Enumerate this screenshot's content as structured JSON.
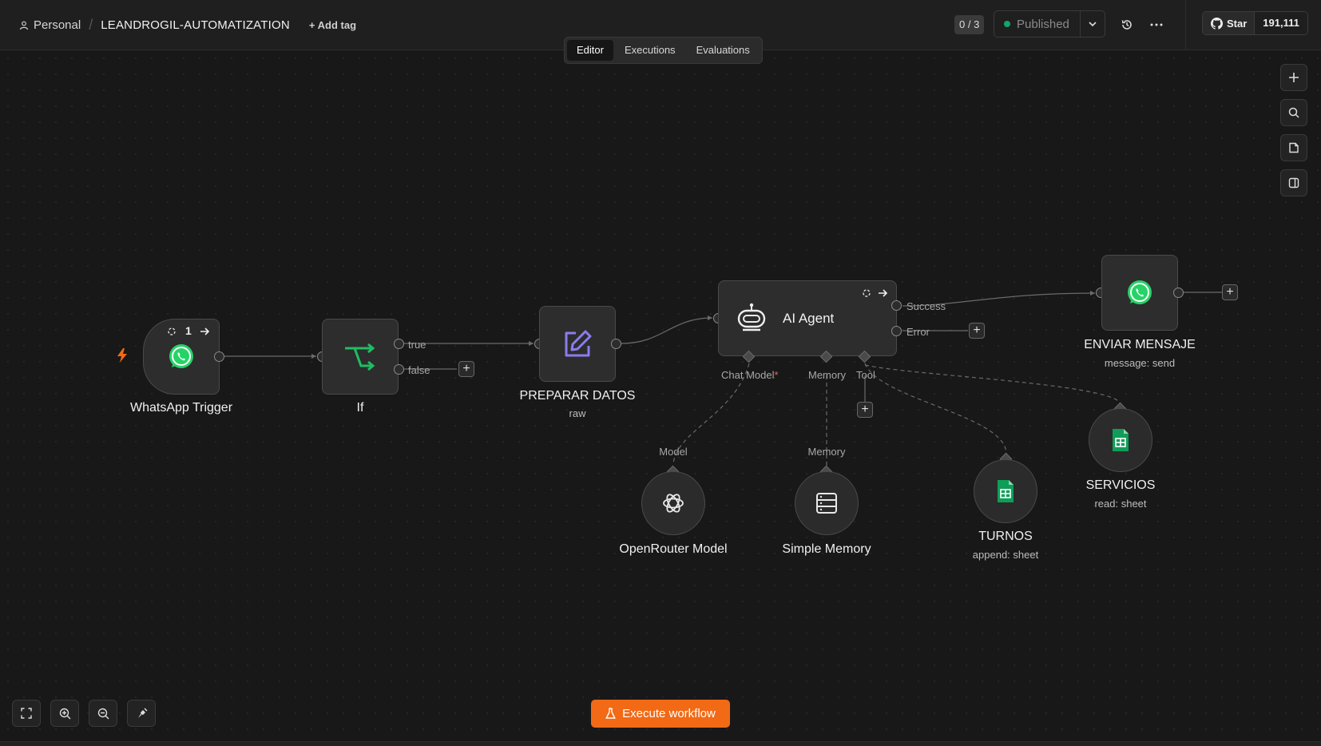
{
  "header": {
    "personal_label": "Personal",
    "workflow_name": "LEANDROGIL-AUTOMATIZATION",
    "add_tag_label": "+ Add tag",
    "counter": "0 / 3",
    "publish_label": "Published",
    "github_star_label": "Star",
    "github_star_count": "191,111"
  },
  "tabs": [
    {
      "label": "Editor",
      "active": true
    },
    {
      "label": "Executions",
      "active": false
    },
    {
      "label": "Evaluations",
      "active": false
    }
  ],
  "nodes": {
    "whatsapp_trigger": {
      "title": "WhatsApp Trigger",
      "badge": "1"
    },
    "if": {
      "title": "If",
      "true_label": "true",
      "false_label": "false"
    },
    "preparar_datos": {
      "title": "PREPARAR DATOS",
      "subtitle": "raw"
    },
    "ai_agent": {
      "title": "AI Agent",
      "success_label": "Success",
      "error_label": "Error",
      "chat_model_label": "Chat Model",
      "required_mark": "*",
      "memory_label": "Memory",
      "tool_label": "Tool"
    },
    "enviar_mensaje": {
      "title": "ENVIAR MENSAJE",
      "subtitle": "message: send"
    },
    "openrouter_model": {
      "title": "OpenRouter Model",
      "port_label": "Model"
    },
    "simple_memory": {
      "title": "Simple Memory",
      "port_label": "Memory"
    },
    "turnos": {
      "title": "TURNOS",
      "subtitle": "append: sheet"
    },
    "servicios": {
      "title": "SERVICIOS",
      "subtitle": "read: sheet"
    }
  },
  "execute_button_label": "Execute workflow",
  "colors": {
    "accent_orange": "#f26a15",
    "whatsapp_green": "#25d366",
    "if_green": "#1fbd62",
    "edit_purple": "#8b7cf0",
    "sheets_green": "#0f9d58",
    "published_dot": "#13a56a"
  },
  "icons": [
    "user-icon",
    "history-icon",
    "more-icon",
    "github-icon",
    "plus-icon",
    "search-icon",
    "sticky-note-icon",
    "panel-icon",
    "fit-view-icon",
    "zoom-in-icon",
    "zoom-out-icon",
    "tidy-up-icon",
    "flask-icon",
    "whatsapp-icon",
    "if-icon",
    "edit-icon",
    "robot-icon",
    "openai-icon",
    "database-icon",
    "sheets-icon",
    "lightning-icon"
  ]
}
